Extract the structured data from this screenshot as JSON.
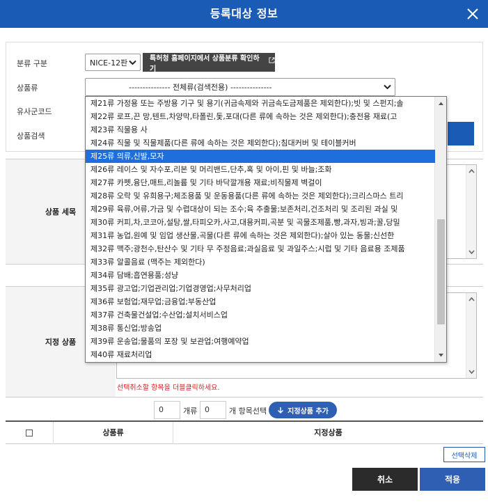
{
  "dialog": {
    "title": "등록대상 정보"
  },
  "filter": {
    "classification_label": "분류 구분",
    "classification_value": "NICE-12판",
    "kipo_link_label": "특허청 홈페이지에서 상품분류 확인하기",
    "goods_class_label": "상품류",
    "goods_class_value": "--------------- 전체류(검색전용) ---------------",
    "similar_code_label": "유사군코드",
    "goods_search_label": "상품검색"
  },
  "class_dropdown": {
    "selected_index": 4,
    "options": [
      "제21류 가정용 또는 주방용 기구 및 용기(귀금속제와 귀금속도금제품은 제외한다);빗 및 스펀지;솔",
      "제22류 로프,끈 망,텐트,차양막,타폴린,돛,포대(다른 류에 속하는 것은 제외한다);충전용 재료(고",
      "제23류 직물용 사",
      "제24류 직물 및 직물제품(다른 류에 속하는 것은 제외한다);침대커버 및 테이블커버",
      "제25류 의류,신발,모자",
      "제26류 레이스 및 자수포,리본 및 머리밴드,단추,혹 및 아이,핀 및 바늘;조화",
      "제27류 카펫,융단,매트,리놀륨 및 기타 바닥깔개용 재료;비직물제 벽걸이",
      "제28류 오락 및 유희용구;체조용품 및 운동용품(다른 류에 속하는 것은 제외한다);크리스마스 트리",
      "제29류 육류,어류,가금 및 수렵대상이 되는 조수;육 추출물;보존처리,건조처리 및 조리된 과실 및",
      "제30류 커피,차,코코아,설탕,쌀,타피오카,사고,대용커피,곡분 및 곡물조제품,빵,과자,빙과;꿀,당밀",
      "제31류 농업,원예 및 임업 생산물,곡물(다른 류에 속하는 것은 제외한다);살아 있는 동물;신선한",
      "제32류 맥주;광천수,탄산수 및 기타 무 주정음료;과실음료 및 과일주스;시럽 및 기타 음료용 조제품",
      "제33류 알콜음료 (맥주는 제외한다)",
      "제34류 담배;흡연용품;성냥",
      "제35류 광고업;기업관리업;기업경영업;사무처리업",
      "제36류 보험업;재무업;금융업;부동산업",
      "제37류 건축물건설업;수산업;설치서비스업",
      "제38류 통신업;방송업",
      "제39류 운송업;물품의 포장 및 보관업;여행예약업",
      "제40류 재료처리업"
    ]
  },
  "sections": {
    "goods_detail_label": "상품 세목",
    "designated_goods_label": "지정 상품",
    "deselect_hint": "선택취소할 항목을 더블클릭하세요."
  },
  "counter": {
    "class_count": "0",
    "class_unit": "개류",
    "item_count": "0",
    "item_unit": "개 항목선택",
    "add_button_label": "지정상품 추가"
  },
  "table": {
    "columns": [
      "상품류",
      "지정상품"
    ]
  },
  "actions": {
    "delete_selected_label": "선택삭제",
    "cancel_label": "취소",
    "apply_label": "적용"
  }
}
